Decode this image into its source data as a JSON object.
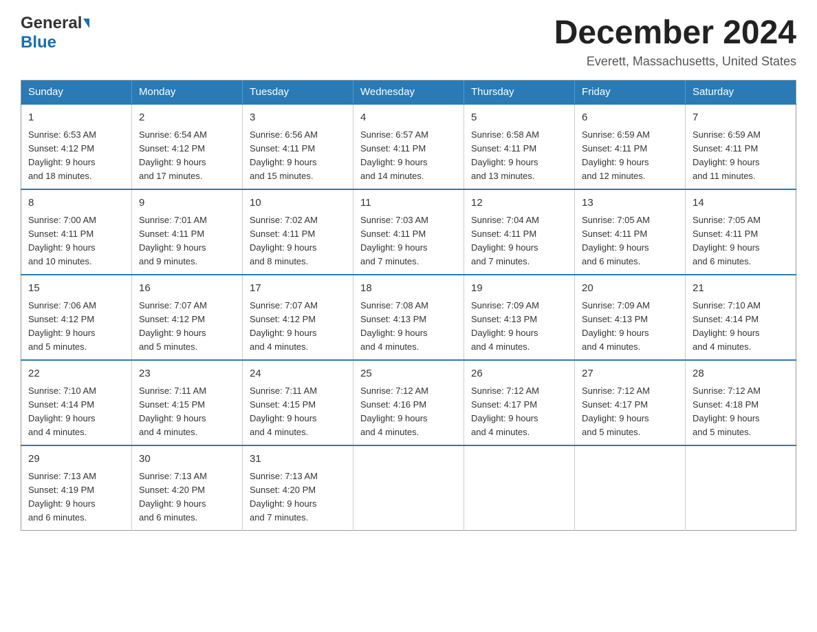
{
  "header": {
    "logo_general": "General",
    "logo_blue": "Blue",
    "month_title": "December 2024",
    "location": "Everett, Massachusetts, United States"
  },
  "weekdays": [
    "Sunday",
    "Monday",
    "Tuesday",
    "Wednesday",
    "Thursday",
    "Friday",
    "Saturday"
  ],
  "weeks": [
    [
      {
        "day": "1",
        "sunrise": "6:53 AM",
        "sunset": "4:12 PM",
        "daylight": "9 hours and 18 minutes."
      },
      {
        "day": "2",
        "sunrise": "6:54 AM",
        "sunset": "4:12 PM",
        "daylight": "9 hours and 17 minutes."
      },
      {
        "day": "3",
        "sunrise": "6:56 AM",
        "sunset": "4:11 PM",
        "daylight": "9 hours and 15 minutes."
      },
      {
        "day": "4",
        "sunrise": "6:57 AM",
        "sunset": "4:11 PM",
        "daylight": "9 hours and 14 minutes."
      },
      {
        "day": "5",
        "sunrise": "6:58 AM",
        "sunset": "4:11 PM",
        "daylight": "9 hours and 13 minutes."
      },
      {
        "day": "6",
        "sunrise": "6:59 AM",
        "sunset": "4:11 PM",
        "daylight": "9 hours and 12 minutes."
      },
      {
        "day": "7",
        "sunrise": "6:59 AM",
        "sunset": "4:11 PM",
        "daylight": "9 hours and 11 minutes."
      }
    ],
    [
      {
        "day": "8",
        "sunrise": "7:00 AM",
        "sunset": "4:11 PM",
        "daylight": "9 hours and 10 minutes."
      },
      {
        "day": "9",
        "sunrise": "7:01 AM",
        "sunset": "4:11 PM",
        "daylight": "9 hours and 9 minutes."
      },
      {
        "day": "10",
        "sunrise": "7:02 AM",
        "sunset": "4:11 PM",
        "daylight": "9 hours and 8 minutes."
      },
      {
        "day": "11",
        "sunrise": "7:03 AM",
        "sunset": "4:11 PM",
        "daylight": "9 hours and 7 minutes."
      },
      {
        "day": "12",
        "sunrise": "7:04 AM",
        "sunset": "4:11 PM",
        "daylight": "9 hours and 7 minutes."
      },
      {
        "day": "13",
        "sunrise": "7:05 AM",
        "sunset": "4:11 PM",
        "daylight": "9 hours and 6 minutes."
      },
      {
        "day": "14",
        "sunrise": "7:05 AM",
        "sunset": "4:11 PM",
        "daylight": "9 hours and 6 minutes."
      }
    ],
    [
      {
        "day": "15",
        "sunrise": "7:06 AM",
        "sunset": "4:12 PM",
        "daylight": "9 hours and 5 minutes."
      },
      {
        "day": "16",
        "sunrise": "7:07 AM",
        "sunset": "4:12 PM",
        "daylight": "9 hours and 5 minutes."
      },
      {
        "day": "17",
        "sunrise": "7:07 AM",
        "sunset": "4:12 PM",
        "daylight": "9 hours and 4 minutes."
      },
      {
        "day": "18",
        "sunrise": "7:08 AM",
        "sunset": "4:13 PM",
        "daylight": "9 hours and 4 minutes."
      },
      {
        "day": "19",
        "sunrise": "7:09 AM",
        "sunset": "4:13 PM",
        "daylight": "9 hours and 4 minutes."
      },
      {
        "day": "20",
        "sunrise": "7:09 AM",
        "sunset": "4:13 PM",
        "daylight": "9 hours and 4 minutes."
      },
      {
        "day": "21",
        "sunrise": "7:10 AM",
        "sunset": "4:14 PM",
        "daylight": "9 hours and 4 minutes."
      }
    ],
    [
      {
        "day": "22",
        "sunrise": "7:10 AM",
        "sunset": "4:14 PM",
        "daylight": "9 hours and 4 minutes."
      },
      {
        "day": "23",
        "sunrise": "7:11 AM",
        "sunset": "4:15 PM",
        "daylight": "9 hours and 4 minutes."
      },
      {
        "day": "24",
        "sunrise": "7:11 AM",
        "sunset": "4:15 PM",
        "daylight": "9 hours and 4 minutes."
      },
      {
        "day": "25",
        "sunrise": "7:12 AM",
        "sunset": "4:16 PM",
        "daylight": "9 hours and 4 minutes."
      },
      {
        "day": "26",
        "sunrise": "7:12 AM",
        "sunset": "4:17 PM",
        "daylight": "9 hours and 4 minutes."
      },
      {
        "day": "27",
        "sunrise": "7:12 AM",
        "sunset": "4:17 PM",
        "daylight": "9 hours and 5 minutes."
      },
      {
        "day": "28",
        "sunrise": "7:12 AM",
        "sunset": "4:18 PM",
        "daylight": "9 hours and 5 minutes."
      }
    ],
    [
      {
        "day": "29",
        "sunrise": "7:13 AM",
        "sunset": "4:19 PM",
        "daylight": "9 hours and 6 minutes."
      },
      {
        "day": "30",
        "sunrise": "7:13 AM",
        "sunset": "4:20 PM",
        "daylight": "9 hours and 6 minutes."
      },
      {
        "day": "31",
        "sunrise": "7:13 AM",
        "sunset": "4:20 PM",
        "daylight": "9 hours and 7 minutes."
      },
      null,
      null,
      null,
      null
    ]
  ],
  "labels": {
    "sunrise": "Sunrise:",
    "sunset": "Sunset:",
    "daylight": "Daylight:"
  }
}
